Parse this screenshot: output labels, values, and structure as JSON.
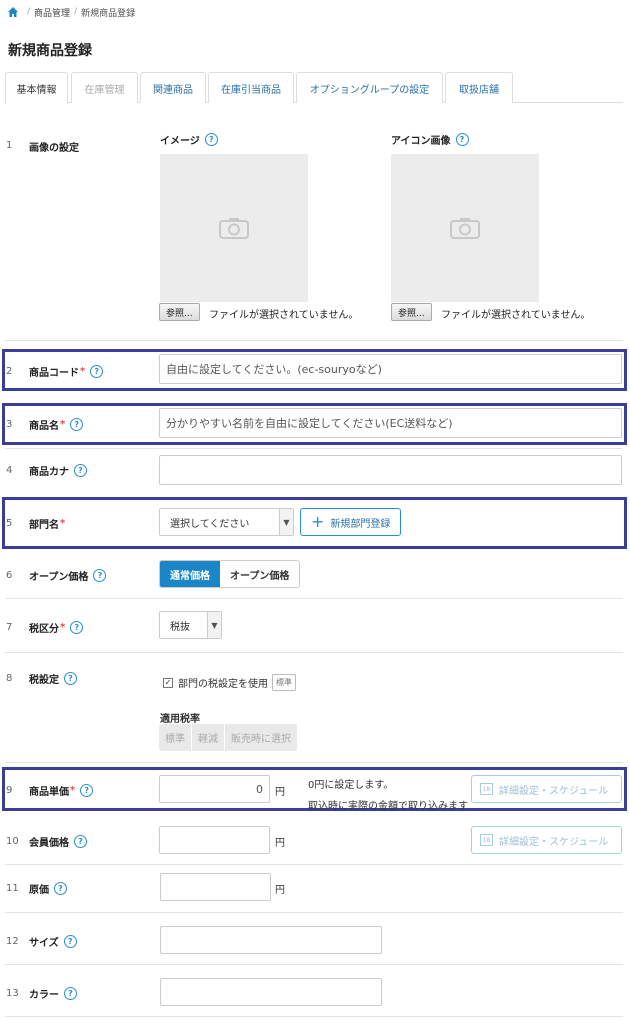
{
  "breadcrumb": {
    "items": [
      "商品管理",
      "新規商品登録"
    ]
  },
  "page": {
    "title": "新規商品登録"
  },
  "tabs": [
    {
      "label": "基本情報",
      "state": "active"
    },
    {
      "label": "在庫管理",
      "state": "disabled"
    },
    {
      "label": "関連商品",
      "state": "normal"
    },
    {
      "label": "在庫引当商品",
      "state": "normal"
    },
    {
      "label": "オプショングループの設定",
      "state": "normal"
    },
    {
      "label": "取扱店舗",
      "state": "normal"
    }
  ],
  "rows": {
    "r1": {
      "num": "1",
      "label": "画像の設定"
    },
    "r2": {
      "num": "2",
      "label": "商品コード"
    },
    "r3": {
      "num": "3",
      "label": "商品名"
    },
    "r4": {
      "num": "4",
      "label": "商品カナ"
    },
    "r5": {
      "num": "5",
      "label": "部門名"
    },
    "r6": {
      "num": "6",
      "label": "オープン価格"
    },
    "r7": {
      "num": "7",
      "label": "税区分"
    },
    "r8": {
      "num": "8",
      "label": "税設定"
    },
    "r9": {
      "num": "9",
      "label": "商品単価"
    },
    "r10": {
      "num": "10",
      "label": "会員価格"
    },
    "r11": {
      "num": "11",
      "label": "原価"
    },
    "r12": {
      "num": "12",
      "label": "サイズ"
    },
    "r13": {
      "num": "13",
      "label": "カラー"
    }
  },
  "required_mark": "*",
  "help_glyph": "?",
  "images": {
    "image": {
      "heading": "イメージ",
      "browse": "参照...",
      "status": "ファイルが選択されていません。"
    },
    "icon": {
      "heading": "アイコン画像",
      "browse": "参照...",
      "status": "ファイルが選択されていません。"
    }
  },
  "fields": {
    "product_code": {
      "value": "自由に設定してください。(ec-souryoなど)"
    },
    "product_name": {
      "value": "分かりやすい名前を自由に設定してください(EC送料など)"
    },
    "product_kana": {
      "value": ""
    },
    "department": {
      "selected": "選択してください",
      "new_button": "新規部門登録",
      "new_icon": "plus-icon"
    },
    "open_price": {
      "options": [
        "通常価格",
        "オープン価格"
      ],
      "selected": "通常価格"
    },
    "tax_class": {
      "selected": "税抜"
    },
    "tax_setting": {
      "checkbox_label": "部門の税設定を使用",
      "checked": true,
      "tag": "標準",
      "rate_heading": "適用税率",
      "rate_options": [
        "標準",
        "軽減",
        "販売時に選択"
      ]
    },
    "unit_price": {
      "value": "0",
      "unit": "円",
      "note_line1": "0円に設定します。",
      "note_line2": "取込時に実際の金額で取り込みます",
      "schedule_button": "詳細設定・スケジュール"
    },
    "member_price": {
      "value": "",
      "unit": "円",
      "schedule_button": "詳細設定・スケジュール"
    },
    "cost": {
      "value": "",
      "unit": "円"
    },
    "size": {
      "value": ""
    },
    "color": {
      "value": ""
    }
  },
  "calendar_glyph": "18",
  "colors": {
    "accent": "#1a86c8",
    "highlight": "#3a3d9a",
    "required": "#d9534f"
  }
}
